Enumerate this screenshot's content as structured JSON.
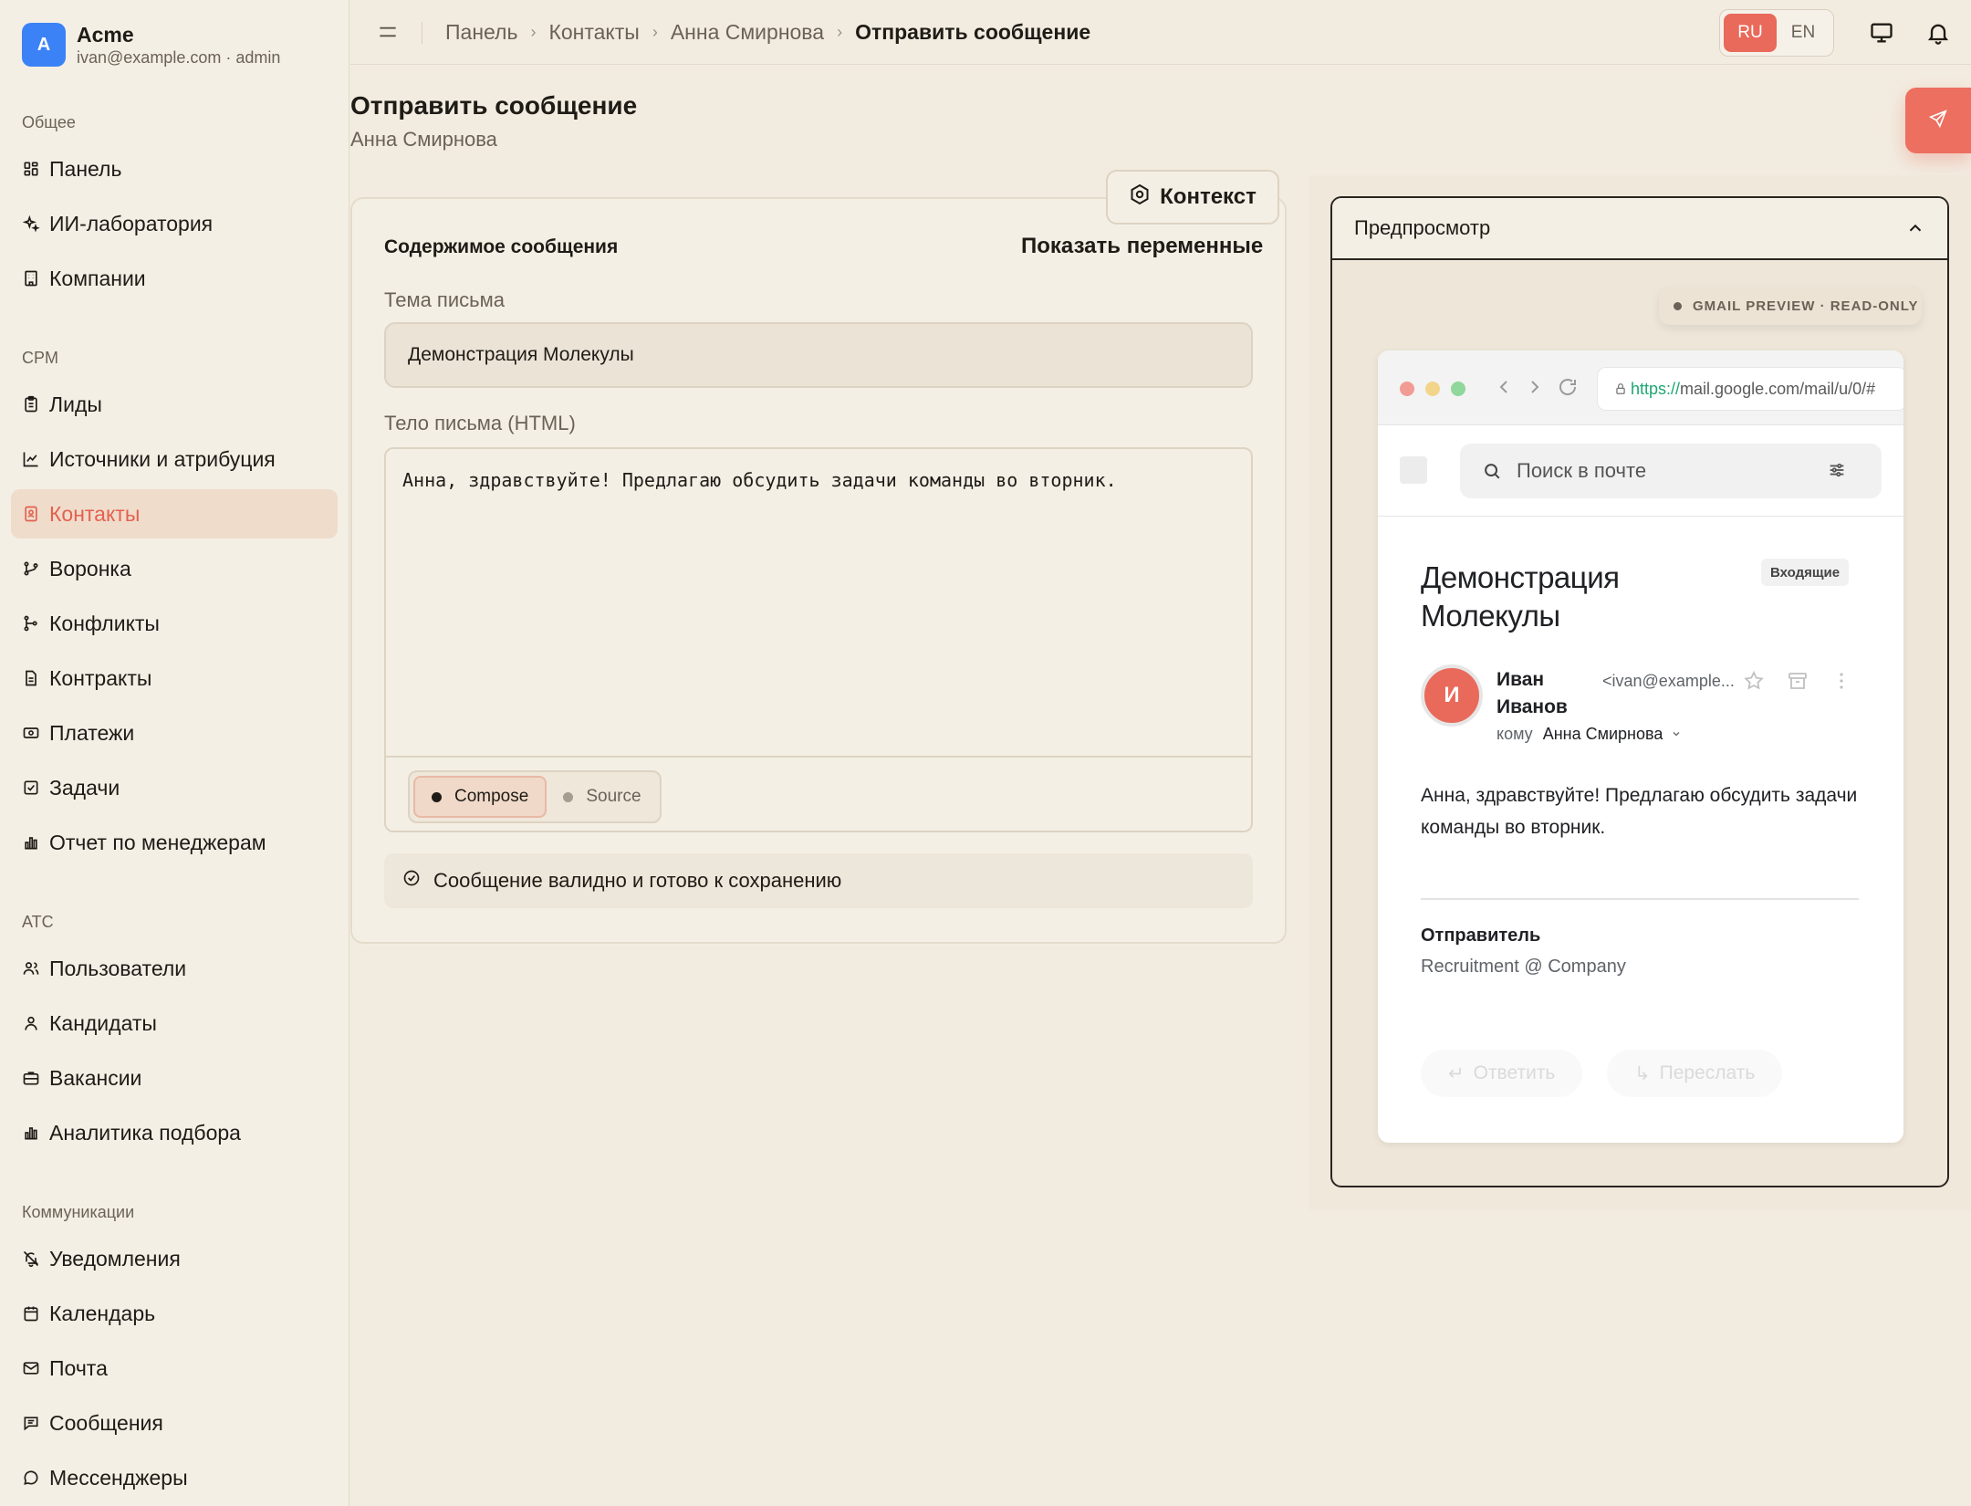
{
  "brand": {
    "initial": "A",
    "name": "Acme",
    "sub": "ivan@example.com · admin"
  },
  "sidebar": {
    "sections": [
      {
        "title": "Общее",
        "items": [
          {
            "label": "Панель",
            "icon": "dashboard-icon"
          },
          {
            "label": "ИИ-лаборатория",
            "icon": "sparkles-icon"
          },
          {
            "label": "Компании",
            "icon": "building-icon"
          }
        ]
      },
      {
        "title": "CPM",
        "items": [
          {
            "label": "Лиды",
            "icon": "clipboard-icon"
          },
          {
            "label": "Источники и атрибуция",
            "icon": "chart-line-icon"
          },
          {
            "label": "Контакты",
            "icon": "contact-card-icon",
            "active": true
          },
          {
            "label": "Воронка",
            "icon": "funnel-icon"
          },
          {
            "label": "Конфликты",
            "icon": "git-branch-icon"
          },
          {
            "label": "Контракты",
            "icon": "document-icon"
          },
          {
            "label": "Платежи",
            "icon": "banknote-icon"
          },
          {
            "label": "Задачи",
            "icon": "checkbox-icon"
          },
          {
            "label": "Отчет по менеджерам",
            "icon": "bar-chart-icon"
          }
        ]
      },
      {
        "title": "ATC",
        "items": [
          {
            "label": "Пользователи",
            "icon": "users-icon"
          },
          {
            "label": "Кандидаты",
            "icon": "user-icon"
          },
          {
            "label": "Вакансии",
            "icon": "briefcase-icon"
          },
          {
            "label": "Аналитика подбора",
            "icon": "bar-chart-icon"
          }
        ]
      },
      {
        "title": "Коммуникации",
        "items": [
          {
            "label": "Уведомления",
            "icon": "bell-off-icon"
          },
          {
            "label": "Календарь",
            "icon": "calendar-icon"
          },
          {
            "label": "Почта",
            "icon": "mail-icon"
          },
          {
            "label": "Сообщения",
            "icon": "message-square-icon"
          },
          {
            "label": "Мессенджеры",
            "icon": "message-circle-icon"
          }
        ]
      }
    ]
  },
  "breadcrumb": [
    "Панель",
    "Контакты",
    "Анна Смирнова",
    "Отправить сообщение"
  ],
  "lang": {
    "ru": "RU",
    "en": "EN",
    "active": "RU"
  },
  "page": {
    "title": "Отправить сообщение",
    "subtitle": "Анна Смирнова"
  },
  "editor": {
    "context_label": "Контекст",
    "heading": "Содержимое сообщения",
    "show_vars": "Показать переменные",
    "subject_label": "Тема письма",
    "subject_value": "Демонстрация Молекулы",
    "body_label": "Тело письма (HTML)",
    "body_value": "Анна, здравствуйте! Предлагаю обсудить задачи команды во вторник.",
    "mode_compose": "Compose",
    "mode_source": "Source",
    "valid_message": "Сообщение валидно и готово к сохранению"
  },
  "preview": {
    "title": "Предпросмотр",
    "badge": "GMAIL PREVIEW · READ-ONLY",
    "url_scheme": "https://",
    "url_rest": "mail.google.com/mail/u/0/#",
    "search_placeholder": "Поиск в почте",
    "subject": "Демонстрация Молекулы",
    "inbox_tag": "Входящие",
    "sender_initial": "И",
    "sender_name": "Иван Иванов",
    "sender_email": "<ivan@example...",
    "to_prefix": "кому",
    "to_name": "Анна Смирнова",
    "body": "Анна, здравствуйте! Предлагаю обсудить задачи команды во вторник.",
    "sig_label": "Отправитель",
    "sig_value": "Recruitment @ Company",
    "reply": "Ответить",
    "forward": "Переслать"
  },
  "colors": {
    "accent": "#e9695a",
    "background": "#f2ece0",
    "active_nav_bg": "#efdccb"
  }
}
